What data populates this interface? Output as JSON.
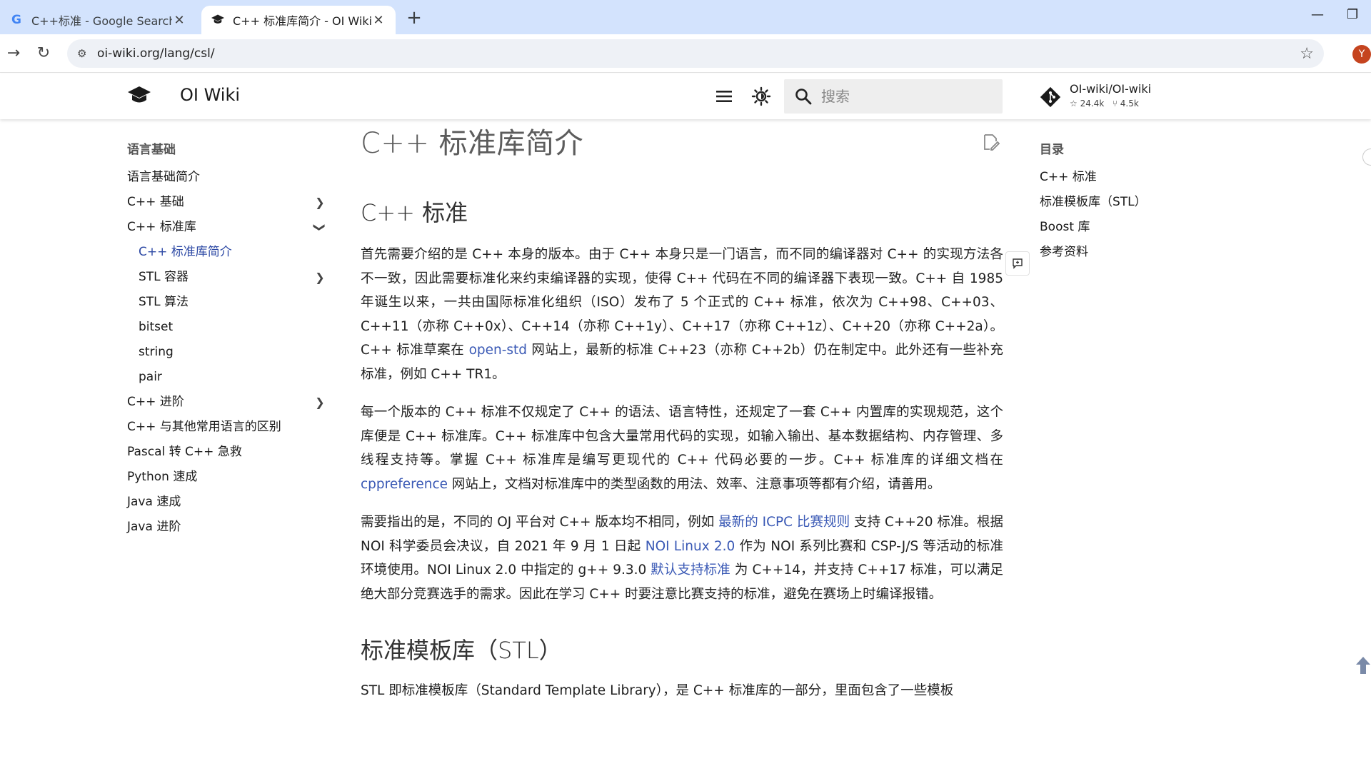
{
  "browser": {
    "tabs": [
      {
        "title": "C++标准 - Google Search",
        "favicon": "google-g-icon"
      },
      {
        "title": "C++ 标准库简介 - OI Wiki",
        "favicon": "graduation-cap-icon"
      }
    ],
    "url": "oi-wiki.org/lang/csl/",
    "profile_initial": "Y",
    "colors": {
      "tabstrip": "#d3e3fd",
      "omnibox": "#eef1f6",
      "profile": "#c5441f"
    }
  },
  "header": {
    "site_name": "OI Wiki",
    "search_placeholder": "搜索",
    "repo": {
      "name": "OI-wiki/OI-wiki",
      "stars": "24.4k",
      "forks": "4.5k"
    }
  },
  "sidebar": {
    "heading": "语言基础",
    "items": [
      {
        "label": "语言基础简介"
      },
      {
        "label": "C++ 基础",
        "chevron": "right"
      },
      {
        "label": "C++ 标准库",
        "chevron": "down"
      },
      {
        "label": "C++ 标准库简介",
        "current": true
      },
      {
        "label": "STL 容器",
        "chevron": "right"
      },
      {
        "label": "STL 算法"
      },
      {
        "label": "bitset"
      },
      {
        "label": "string"
      },
      {
        "label": "pair"
      },
      {
        "label": "C++ 进阶",
        "chevron": "right"
      },
      {
        "label": "C++ 与其他常用语言的区别"
      },
      {
        "label": "Pascal 转 C++ 急救"
      },
      {
        "label": "Python 速成"
      },
      {
        "label": "Java 速成"
      },
      {
        "label": "Java 进阶"
      }
    ]
  },
  "content": {
    "title": "C++ 标准库简介",
    "section1": "C++ 标准",
    "p1": {
      "a": "首先需要介绍的是 C++ 本身的版本。由于 C++ 本身只是一门语言，而不同的编译器对 C++ 的实现方法各不一致，因此需要标准化来约束编译器的实现，使得 C++ 代码在不同的编译器下表现一致。C++ 自 1985 年诞生以来，一共由国际标准化组织（ISO）发布了 5 个正式的 C++ 标准，依次为 C++98、C++03、C++11（亦称 C++0x）、C++14（亦称 C++1y）、C++17（亦称 C++1z）、C++20（亦称 C++2a）。C++ 标准草案在 ",
      "link": "open-std",
      "b": " 网站上，最新的标准 C++23（亦称 C++2b）仍在制定中。此外还有一些补充标准，例如 C++ TR1。"
    },
    "p2": {
      "a": "每一个版本的 C++ 标准不仅规定了 C++ 的语法、语言特性，还规定了一套 C++ 内置库的实现规范，这个库便是 C++ 标准库。C++ 标准库中包含大量常用代码的实现，如输入输出、基本数据结构、内存管理、多线程支持等。掌握 C++ 标准库是编写更现代的 C++ 代码必要的一步。C++ 标准库的详细文档在 ",
      "link": "cppreference",
      "b": " 网站上，文档对标准库中的类型函数的用法、效率、注意事项等都有介绍，请善用。"
    },
    "p3": {
      "a": "需要指出的是，不同的 OJ 平台对 C++ 版本均不相同，例如 ",
      "link1": "最新的 ICPC 比赛规则",
      "b": " 支持 C++20 标准。根据 NOI 科学委员会决议，自 2021 年 9 月 1 日起 ",
      "link2": "NOI Linux 2.0",
      "c": " 作为 NOI 系列比赛和 CSP-J/S 等活动的标准环境使用。NOI Linux 2.0 中指定的 g++ 9.3.0 ",
      "link3": "默认支持标准",
      "d": " 为 C++14，并支持 C++17 标准，可以满足绝大部分竞赛选手的需求。因此在学习 C++ 时要注意比赛支持的标准，避免在赛场上时编译报错。"
    },
    "section2": "标准模板库（STL）",
    "p4": "STL 即标准模板库（Standard Template Library），是 C++ 标准库的一部分，里面包含了一些模板"
  },
  "toc": {
    "heading": "目录",
    "items": [
      "C++ 标准",
      "标准模板库（STL）",
      "Boost 库",
      "参考资料"
    ]
  },
  "colors": {
    "link": "#3a59b5",
    "current_nav": "#2e4aa5"
  }
}
